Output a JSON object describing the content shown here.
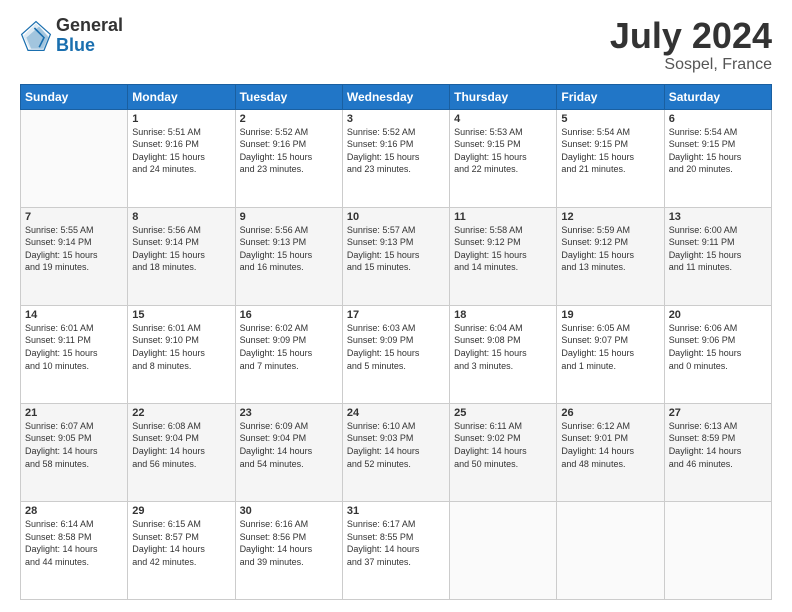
{
  "header": {
    "logo_general": "General",
    "logo_blue": "Blue",
    "title": "July 2024",
    "location": "Sospel, France"
  },
  "days_of_week": [
    "Sunday",
    "Monday",
    "Tuesday",
    "Wednesday",
    "Thursday",
    "Friday",
    "Saturday"
  ],
  "weeks": [
    [
      {
        "day": "",
        "sunrise": "",
        "sunset": "",
        "daylight": ""
      },
      {
        "day": "1",
        "sunrise": "Sunrise: 5:51 AM",
        "sunset": "Sunset: 9:16 PM",
        "daylight": "Daylight: 15 hours and 24 minutes."
      },
      {
        "day": "2",
        "sunrise": "Sunrise: 5:52 AM",
        "sunset": "Sunset: 9:16 PM",
        "daylight": "Daylight: 15 hours and 23 minutes."
      },
      {
        "day": "3",
        "sunrise": "Sunrise: 5:52 AM",
        "sunset": "Sunset: 9:16 PM",
        "daylight": "Daylight: 15 hours and 23 minutes."
      },
      {
        "day": "4",
        "sunrise": "Sunrise: 5:53 AM",
        "sunset": "Sunset: 9:15 PM",
        "daylight": "Daylight: 15 hours and 22 minutes."
      },
      {
        "day": "5",
        "sunrise": "Sunrise: 5:54 AM",
        "sunset": "Sunset: 9:15 PM",
        "daylight": "Daylight: 15 hours and 21 minutes."
      },
      {
        "day": "6",
        "sunrise": "Sunrise: 5:54 AM",
        "sunset": "Sunset: 9:15 PM",
        "daylight": "Daylight: 15 hours and 20 minutes."
      }
    ],
    [
      {
        "day": "7",
        "sunrise": "Sunrise: 5:55 AM",
        "sunset": "Sunset: 9:14 PM",
        "daylight": "Daylight: 15 hours and 19 minutes."
      },
      {
        "day": "8",
        "sunrise": "Sunrise: 5:56 AM",
        "sunset": "Sunset: 9:14 PM",
        "daylight": "Daylight: 15 hours and 18 minutes."
      },
      {
        "day": "9",
        "sunrise": "Sunrise: 5:56 AM",
        "sunset": "Sunset: 9:13 PM",
        "daylight": "Daylight: 15 hours and 16 minutes."
      },
      {
        "day": "10",
        "sunrise": "Sunrise: 5:57 AM",
        "sunset": "Sunset: 9:13 PM",
        "daylight": "Daylight: 15 hours and 15 minutes."
      },
      {
        "day": "11",
        "sunrise": "Sunrise: 5:58 AM",
        "sunset": "Sunset: 9:12 PM",
        "daylight": "Daylight: 15 hours and 14 minutes."
      },
      {
        "day": "12",
        "sunrise": "Sunrise: 5:59 AM",
        "sunset": "Sunset: 9:12 PM",
        "daylight": "Daylight: 15 hours and 13 minutes."
      },
      {
        "day": "13",
        "sunrise": "Sunrise: 6:00 AM",
        "sunset": "Sunset: 9:11 PM",
        "daylight": "Daylight: 15 hours and 11 minutes."
      }
    ],
    [
      {
        "day": "14",
        "sunrise": "Sunrise: 6:01 AM",
        "sunset": "Sunset: 9:11 PM",
        "daylight": "Daylight: 15 hours and 10 minutes."
      },
      {
        "day": "15",
        "sunrise": "Sunrise: 6:01 AM",
        "sunset": "Sunset: 9:10 PM",
        "daylight": "Daylight: 15 hours and 8 minutes."
      },
      {
        "day": "16",
        "sunrise": "Sunrise: 6:02 AM",
        "sunset": "Sunset: 9:09 PM",
        "daylight": "Daylight: 15 hours and 7 minutes."
      },
      {
        "day": "17",
        "sunrise": "Sunrise: 6:03 AM",
        "sunset": "Sunset: 9:09 PM",
        "daylight": "Daylight: 15 hours and 5 minutes."
      },
      {
        "day": "18",
        "sunrise": "Sunrise: 6:04 AM",
        "sunset": "Sunset: 9:08 PM",
        "daylight": "Daylight: 15 hours and 3 minutes."
      },
      {
        "day": "19",
        "sunrise": "Sunrise: 6:05 AM",
        "sunset": "Sunset: 9:07 PM",
        "daylight": "Daylight: 15 hours and 1 minute."
      },
      {
        "day": "20",
        "sunrise": "Sunrise: 6:06 AM",
        "sunset": "Sunset: 9:06 PM",
        "daylight": "Daylight: 15 hours and 0 minutes."
      }
    ],
    [
      {
        "day": "21",
        "sunrise": "Sunrise: 6:07 AM",
        "sunset": "Sunset: 9:05 PM",
        "daylight": "Daylight: 14 hours and 58 minutes."
      },
      {
        "day": "22",
        "sunrise": "Sunrise: 6:08 AM",
        "sunset": "Sunset: 9:04 PM",
        "daylight": "Daylight: 14 hours and 56 minutes."
      },
      {
        "day": "23",
        "sunrise": "Sunrise: 6:09 AM",
        "sunset": "Sunset: 9:04 PM",
        "daylight": "Daylight: 14 hours and 54 minutes."
      },
      {
        "day": "24",
        "sunrise": "Sunrise: 6:10 AM",
        "sunset": "Sunset: 9:03 PM",
        "daylight": "Daylight: 14 hours and 52 minutes."
      },
      {
        "day": "25",
        "sunrise": "Sunrise: 6:11 AM",
        "sunset": "Sunset: 9:02 PM",
        "daylight": "Daylight: 14 hours and 50 minutes."
      },
      {
        "day": "26",
        "sunrise": "Sunrise: 6:12 AM",
        "sunset": "Sunset: 9:01 PM",
        "daylight": "Daylight: 14 hours and 48 minutes."
      },
      {
        "day": "27",
        "sunrise": "Sunrise: 6:13 AM",
        "sunset": "Sunset: 8:59 PM",
        "daylight": "Daylight: 14 hours and 46 minutes."
      }
    ],
    [
      {
        "day": "28",
        "sunrise": "Sunrise: 6:14 AM",
        "sunset": "Sunset: 8:58 PM",
        "daylight": "Daylight: 14 hours and 44 minutes."
      },
      {
        "day": "29",
        "sunrise": "Sunrise: 6:15 AM",
        "sunset": "Sunset: 8:57 PM",
        "daylight": "Daylight: 14 hours and 42 minutes."
      },
      {
        "day": "30",
        "sunrise": "Sunrise: 6:16 AM",
        "sunset": "Sunset: 8:56 PM",
        "daylight": "Daylight: 14 hours and 39 minutes."
      },
      {
        "day": "31",
        "sunrise": "Sunrise: 6:17 AM",
        "sunset": "Sunset: 8:55 PM",
        "daylight": "Daylight: 14 hours and 37 minutes."
      },
      {
        "day": "",
        "sunrise": "",
        "sunset": "",
        "daylight": ""
      },
      {
        "day": "",
        "sunrise": "",
        "sunset": "",
        "daylight": ""
      },
      {
        "day": "",
        "sunrise": "",
        "sunset": "",
        "daylight": ""
      }
    ]
  ]
}
